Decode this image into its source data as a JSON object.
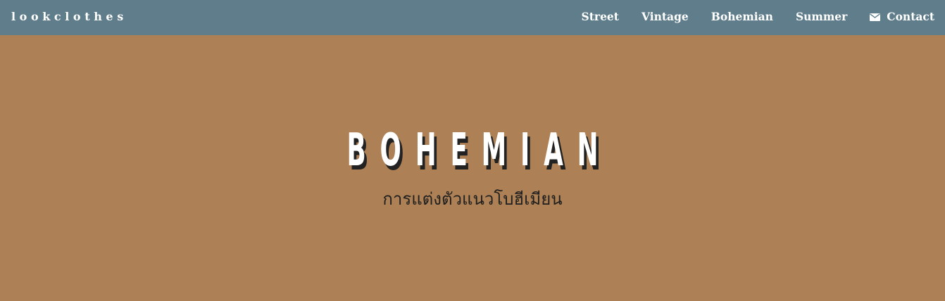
{
  "navbar": {
    "brand": "lookclothes",
    "links": [
      {
        "label": "Street"
      },
      {
        "label": "Vintage"
      },
      {
        "label": "Bohemian"
      },
      {
        "label": "Summer"
      },
      {
        "label": "Contact",
        "icon": "envelope-icon"
      }
    ]
  },
  "hero": {
    "title": "BOHEMIAN",
    "subtitle": "การแต่งตัวแนวโบฮีเมียน"
  },
  "colors": {
    "navbar_background": "#607d8b",
    "page_background": "#ad8155",
    "nav_text": "#ffffff",
    "title_text": "#ffffff",
    "title_shadow": "#222222",
    "subtitle_text": "#1f1f1f"
  }
}
